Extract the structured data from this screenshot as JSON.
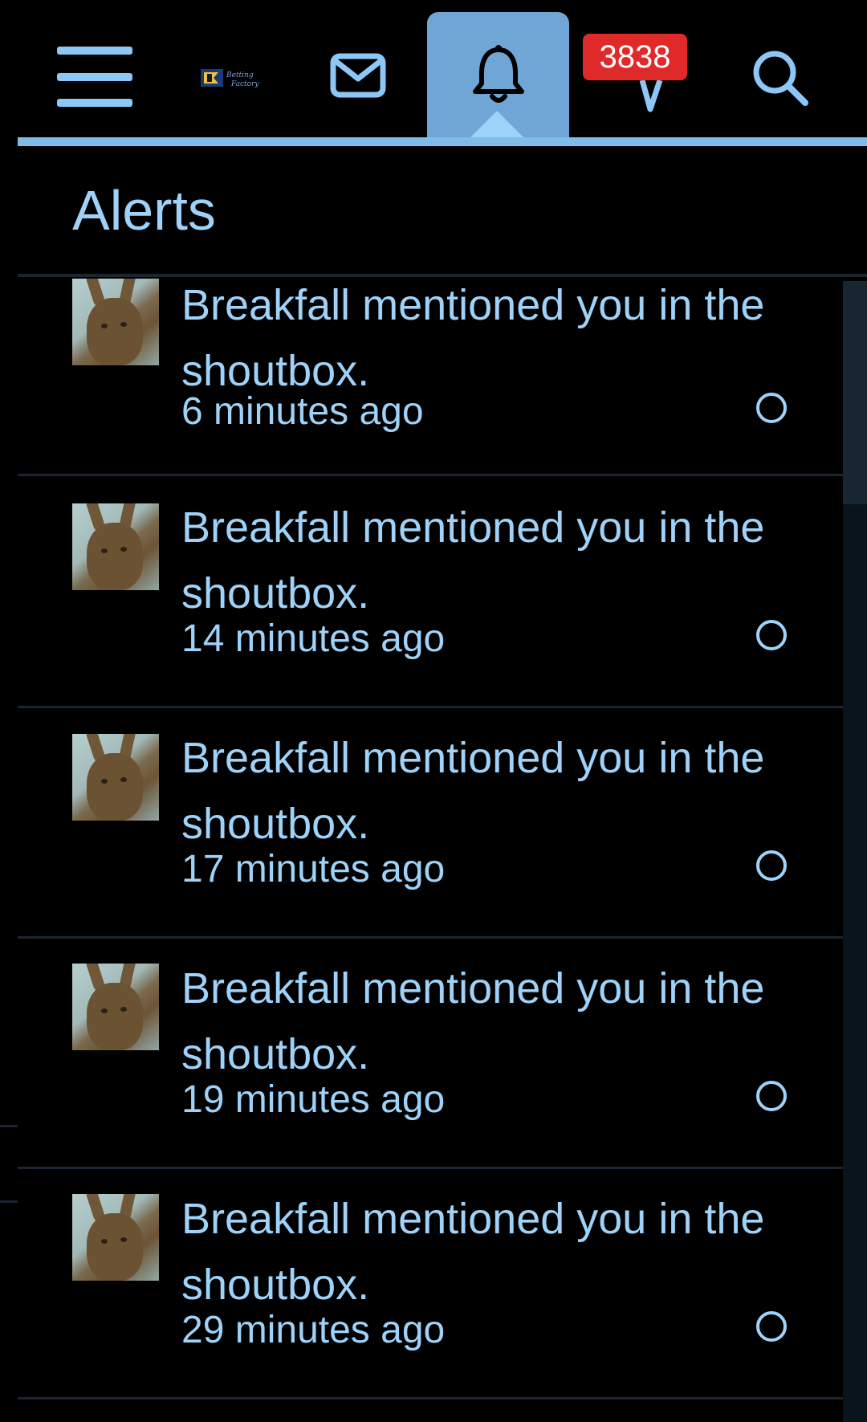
{
  "header": {
    "logo_text": "Betting Factory",
    "badge_count": "3838",
    "icons": [
      "menu-icon",
      "mail-icon",
      "bell-icon",
      "conversation-icon",
      "search-icon"
    ],
    "accent_color": "#8cc7f5",
    "active_tab_color": "#6fa6d6",
    "badge_color": "#e02a2a"
  },
  "panel": {
    "title": "Alerts"
  },
  "alerts": [
    {
      "text": "Breakfall mentioned you in the shoutbox.",
      "time": "6 minutes ago"
    },
    {
      "text": "Breakfall mentioned you in the shoutbox.",
      "time": "14 minutes ago"
    },
    {
      "text": "Breakfall mentioned you in the shoutbox.",
      "time": "17 minutes ago"
    },
    {
      "text": "Breakfall mentioned you in the shoutbox.",
      "time": "19 minutes ago"
    },
    {
      "text": "Breakfall mentioned you in the shoutbox.",
      "time": "29 minutes ago"
    }
  ]
}
